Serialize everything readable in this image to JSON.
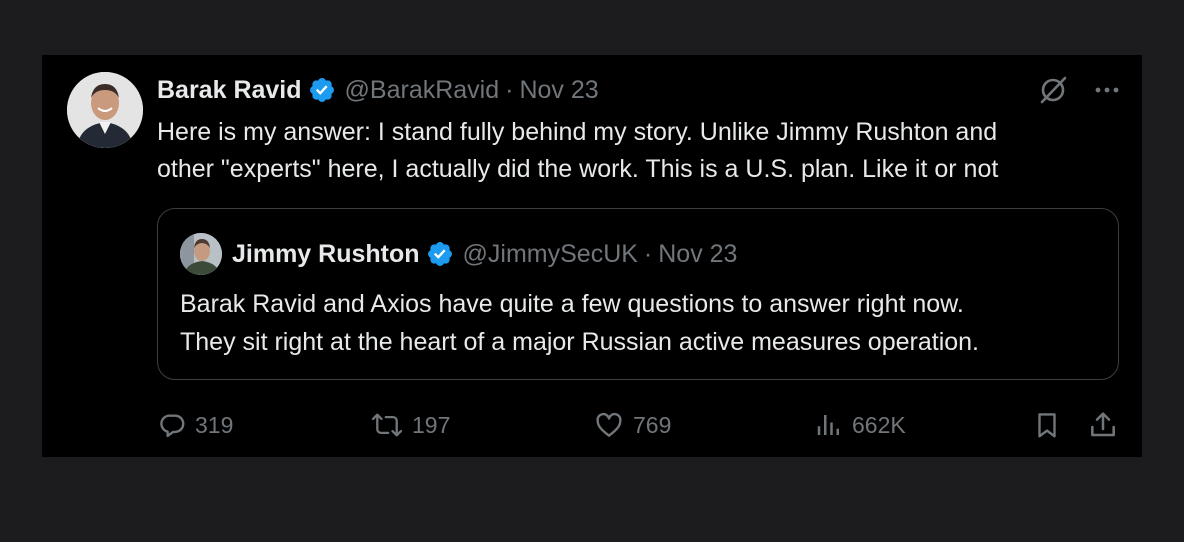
{
  "tweet": {
    "author": {
      "display_name": "Barak Ravid",
      "handle": "@BarakRavid",
      "verified": true
    },
    "separator": "·",
    "date": "Nov 23",
    "text_lines": [
      "Here is my answer: I stand fully behind my story. Unlike Jimmy Rushton and",
      "other \"experts\" here, I actually did the work. This is a U.S. plan. Like it or not"
    ],
    "top_icons": [
      "grok-icon",
      "more-icon"
    ]
  },
  "quoted_tweet": {
    "author": {
      "display_name": "Jimmy Rushton",
      "handle": "@JimmySecUK",
      "verified": true
    },
    "separator": "·",
    "date": "Nov 23",
    "text_lines": [
      "Barak Ravid and Axios have quite a few questions to answer right now.",
      "They sit right at the heart of a major Russian active measures operation."
    ]
  },
  "actions": {
    "replies": "319",
    "reposts": "197",
    "likes": "769",
    "views": "662K"
  },
  "colors": {
    "page_background": "#1c1c1f",
    "card_background": "#000000",
    "primary_text": "#e7e9ea",
    "secondary_text": "#71767b",
    "verified_badge": "#1d9bf0",
    "quote_border": "#3b3f43"
  }
}
